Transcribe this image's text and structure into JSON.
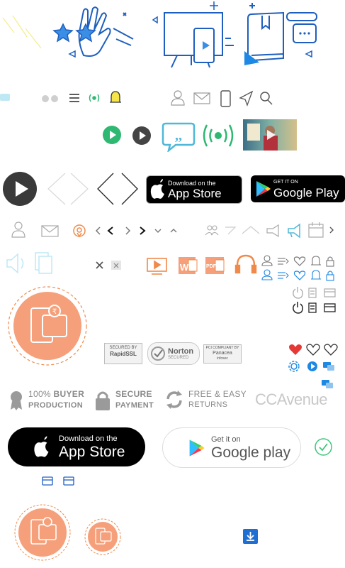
{
  "stores": {
    "appstore_small": {
      "top": "Download on the",
      "main": "App Store"
    },
    "googleplay_small": {
      "top": "GET IT ON",
      "main": "Google Play"
    },
    "appstore_large": {
      "top": "Download on the",
      "main": "App Store"
    },
    "googleplay_large": {
      "top": "Get it on",
      "main": "Google play"
    }
  },
  "security_badges": {
    "rapidssl": {
      "top": "SECURED BY",
      "main": "RapidSSL"
    },
    "norton": {
      "main": "Norton",
      "sub": "SECURED"
    },
    "pci": {
      "top": "PCI COMPLIANT BY",
      "main": "Panacea",
      "sub": "infosec"
    }
  },
  "features": {
    "buyer": {
      "line1_prefix": "100%",
      "line1_bold": "BUYER",
      "line2": "PRODUCTION"
    },
    "secure": {
      "line1": "SECURE",
      "line2": "PAYMENT"
    },
    "returns": {
      "line1": "FREE & EASY",
      "line2": "RETURNS"
    }
  },
  "ccavenue": {
    "text": "CCAvenue"
  },
  "icon_labels": {
    "rupee": "₹",
    "pdf": "PDF",
    "word": "W"
  },
  "colors": {
    "accent_blue": "#1e88e5",
    "green": "#2eb872",
    "orange": "#f4a37a",
    "dark": "#333333",
    "light_gray": "#c8c8c8",
    "teal": "#4fb8d8",
    "red_heart": "#e53935",
    "check_green": "#3cc77a"
  }
}
